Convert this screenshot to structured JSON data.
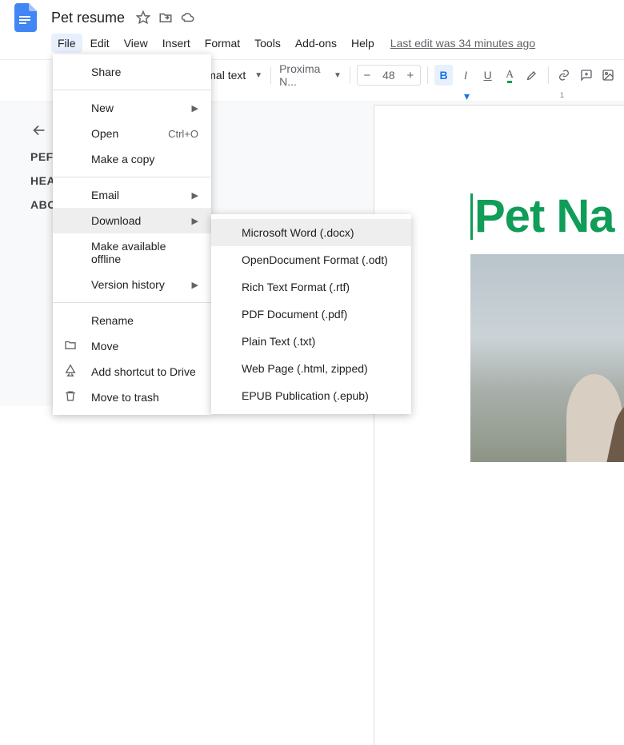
{
  "header": {
    "doc_title": "Pet resume",
    "last_edit": "Last edit was 34 minutes ago"
  },
  "menubar": {
    "items": [
      "File",
      "Edit",
      "View",
      "Insert",
      "Format",
      "Tools",
      "Add-ons",
      "Help"
    ]
  },
  "toolbar": {
    "para_style": "ormal text",
    "font_name": "Proxima N...",
    "font_size": "48",
    "bold": "B",
    "italic": "I",
    "underline": "U",
    "textcolor": "A"
  },
  "outline": {
    "items": [
      "PEF",
      "HEA",
      "ABO"
    ]
  },
  "ruler": {
    "num1": "1"
  },
  "file_menu": {
    "share": "Share",
    "new": "New",
    "open": "Open",
    "open_shortcut": "Ctrl+O",
    "copy": "Make a copy",
    "email": "Email",
    "download": "Download",
    "offline": "Make available offline",
    "history": "Version history",
    "rename": "Rename",
    "move": "Move",
    "shortcut": "Add shortcut to Drive",
    "trash": "Move to trash"
  },
  "download_submenu": {
    "items": [
      "Microsoft Word (.docx)",
      "OpenDocument Format (.odt)",
      "Rich Text Format (.rtf)",
      "PDF Document (.pdf)",
      "Plain Text (.txt)",
      "Web Page (.html, zipped)",
      "EPUB Publication (.epub)"
    ]
  },
  "document": {
    "heading": "Pet Na"
  }
}
